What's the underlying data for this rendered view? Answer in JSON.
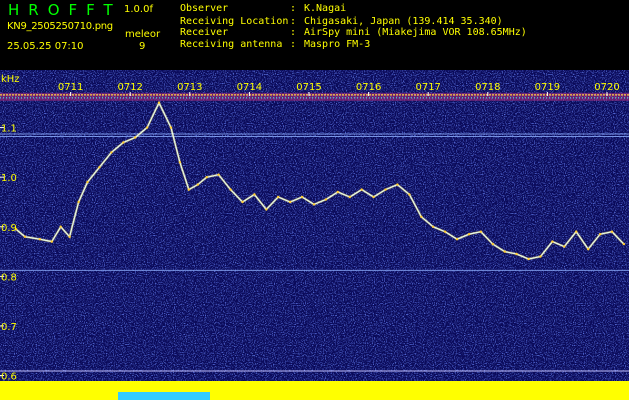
{
  "header": {
    "app_title": "HROFFT",
    "version": "1.0.0f",
    "filename": "KN9_2505250710.png",
    "mode": "meleor",
    "datetime": "25.05.25 07:10",
    "count": "9",
    "info": [
      {
        "label": "Observer",
        "value": "K.Nagai"
      },
      {
        "label": "Receiving Location",
        "value": "Chigasaki, Japan (139.414 35.340)"
      },
      {
        "label": "Receiver",
        "value": "AirSpy mini (Miakejima VOR 108.65MHz)"
      },
      {
        "label": "Receiving antenna",
        "value": "Maspro FM-3"
      }
    ]
  },
  "colors": {
    "title_green": "#00ff00",
    "label_yellow": "#ffff00",
    "background_navy": "#0a0a5a",
    "axis_white": "#ffffff"
  },
  "chart_data": {
    "type": "heatmap",
    "title": "",
    "ylabel": "kHz",
    "xlabel": "",
    "x_ticks": [
      "0711",
      "0712",
      "0713",
      "0714",
      "0715",
      "0716",
      "0717",
      "0718",
      "0719",
      "0720"
    ],
    "y_ticks": [
      "1.1",
      "1.0",
      "0.9",
      "0.8",
      "0.7",
      "0.6"
    ],
    "y_tick_values": [
      1.1,
      1.0,
      0.9,
      0.8,
      0.7,
      0.6
    ],
    "ylim": [
      0.595,
      1.2
    ],
    "xlim": [
      0.0,
      10.28
    ],
    "carrier_lines_khz": [
      1.162,
      1.087,
      1.082,
      0.812
    ],
    "trace": {
      "name": "",
      "x": [
        0.0,
        0.15,
        0.4,
        0.6,
        0.75,
        0.9,
        1.05,
        1.2,
        1.4,
        1.6,
        1.8,
        2.0,
        2.2,
        2.4,
        2.6,
        2.75,
        2.9,
        3.05,
        3.2,
        3.4,
        3.6,
        3.8,
        4.0,
        4.2,
        4.4,
        4.6,
        4.8,
        5.0,
        5.2,
        5.4,
        5.6,
        5.8,
        6.0,
        6.2,
        6.4,
        6.6,
        6.8,
        7.0,
        7.2,
        7.4,
        7.6,
        7.8,
        8.0,
        8.2,
        8.4,
        8.6,
        8.8,
        9.0,
        9.2,
        9.4,
        9.6,
        9.8,
        10.0,
        10.2
      ],
      "y": [
        0.895,
        0.88,
        0.875,
        0.87,
        0.9,
        0.88,
        0.95,
        0.99,
        1.02,
        1.05,
        1.07,
        1.08,
        1.1,
        1.15,
        1.1,
        1.03,
        0.975,
        0.985,
        1.0,
        1.005,
        0.975,
        0.95,
        0.965,
        0.935,
        0.96,
        0.95,
        0.96,
        0.945,
        0.955,
        0.97,
        0.96,
        0.975,
        0.96,
        0.975,
        0.985,
        0.965,
        0.92,
        0.9,
        0.89,
        0.875,
        0.885,
        0.89,
        0.865,
        0.85,
        0.845,
        0.835,
        0.84,
        0.87,
        0.86,
        0.89,
        0.855,
        0.885,
        0.89,
        0.865
      ]
    },
    "grid": false
  }
}
